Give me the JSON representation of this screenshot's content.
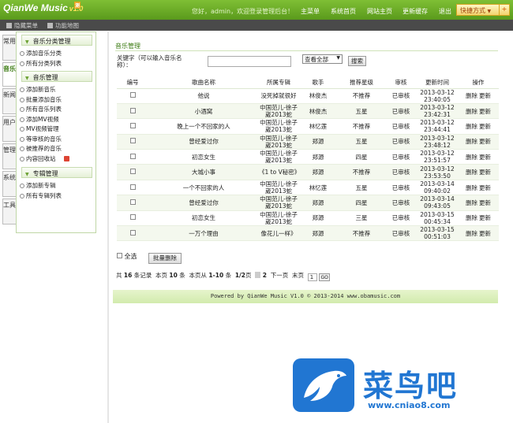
{
  "header": {
    "logo": "QianWe Music",
    "version": "v1.0",
    "badge": "测",
    "greeting": "您好，admin，欢迎登录管理后台！",
    "nav": [
      "主菜单",
      "系统首页",
      "网站主页",
      "更新缓存",
      "退出"
    ],
    "quick": "快捷方式"
  },
  "subbar": {
    "hide_menu": "隐藏菜单",
    "sitemap": "功能地图"
  },
  "vtabs": [
    "常用",
    "音乐",
    "新闻",
    "用户",
    "管理",
    "系统",
    "工具"
  ],
  "sidebar": {
    "sections": [
      {
        "title": "音乐分类管理",
        "items": [
          "添加音乐分类",
          "所有分类列表"
        ]
      },
      {
        "title": "音乐管理",
        "items": [
          "添加新音乐",
          "批量添加音乐",
          "所有音乐列表",
          "添加MV视频",
          "MV视频管理",
          "等审核的音乐",
          "被推荐的音乐",
          "内容回收站"
        ]
      },
      {
        "title": "专辑管理",
        "items": [
          "添加新专辑",
          "所有专辑列表"
        ]
      }
    ]
  },
  "main": {
    "breadcrumb": "音乐管理",
    "keyword_label": "关键字（可以输入音乐名称）：",
    "filter_value": "查看全部",
    "search_button": "搜索",
    "columns": [
      "编号",
      "歌曲名称",
      "所属专辑",
      "歌手",
      "推荐星级",
      "审核",
      "更新时间",
      "操作"
    ],
    "rows": [
      {
        "name": "他说",
        "album": "没死掉就很好",
        "singer": "林俊杰",
        "stars": "不推荐",
        "status": "已审核",
        "date": "2013-03-12",
        "time": "23:40:05"
      },
      {
        "name": "小酒窝",
        "album": "中国范儿-徐子崴2013蛇",
        "singer": "林俊杰",
        "stars": "五星",
        "status": "已审核",
        "date": "2013-03-12",
        "time": "23:42:31"
      },
      {
        "name": "晚上一个不回家的人",
        "album": "中国范儿-徐子崴2013蛇",
        "singer": "林忆莲",
        "stars": "不推荐",
        "status": "已审核",
        "date": "2013-03-12",
        "time": "23:44:41"
      },
      {
        "name": "曾经爱过你",
        "album": "中国范儿-徐子崴2013蛇",
        "singer": "郑源",
        "stars": "五星",
        "status": "已审核",
        "date": "2013-03-12",
        "time": "23:48:12"
      },
      {
        "name": "初恋女生",
        "album": "中国范儿-徐子崴2013蛇",
        "singer": "郑源",
        "stars": "四星",
        "status": "已审核",
        "date": "2013-03-12",
        "time": "23:51:57"
      },
      {
        "name": "大城小事",
        "album": "《1 to V秘密》",
        "singer": "郑源",
        "stars": "不推荐",
        "status": "已审核",
        "date": "2013-03-12",
        "time": "23:53:50"
      },
      {
        "name": "一个不回家的人",
        "album": "中国范儿-徐子崴2013蛇",
        "singer": "林忆莲",
        "stars": "五星",
        "status": "已审核",
        "date": "2013-03-14",
        "time": "09:40:02"
      },
      {
        "name": "曾经爱过你",
        "album": "中国范儿-徐子崴2013蛇",
        "singer": "郑源",
        "stars": "四星",
        "status": "已审核",
        "date": "2013-03-14",
        "time": "09:43:05"
      },
      {
        "name": "初恋女生",
        "album": "中国范儿-徐子崴2013蛇",
        "singer": "郑源",
        "stars": "三星",
        "status": "已审核",
        "date": "2013-03-15",
        "time": "00:45:34"
      },
      {
        "name": "一万个理由",
        "album": "像花儿一样》",
        "singer": "郑源",
        "stars": "不推荐",
        "status": "已审核",
        "date": "2013-03-15",
        "time": "00:51:03"
      }
    ],
    "op_delete": "删除",
    "op_update": "更新",
    "select_all": "全选",
    "batch_delete": "批量删除",
    "pager": {
      "total_prefix": "共",
      "total": "16",
      "total_suffix": "条记录",
      "perpage_prefix": "本页",
      "perpage": "10",
      "perpage_suffix": "条",
      "range_prefix": "本页从",
      "range": "1-10",
      "range_suffix": "条",
      "pages": "1/2",
      "pages_suffix": "页",
      "current": "1",
      "next_num": "2",
      "next": "下一页",
      "last": "末页",
      "input": "1",
      "go": "GO"
    },
    "footer": "Powered by QianWe Music V1.0 © 2013-2014 www.obamusic.com"
  },
  "watermark": {
    "text": "菜鸟吧",
    "url": "www.cniao8.com"
  },
  "colors": {
    "header_green": "#6aad28",
    "accent": "#3a7a10",
    "watermark": "#2176d2"
  }
}
